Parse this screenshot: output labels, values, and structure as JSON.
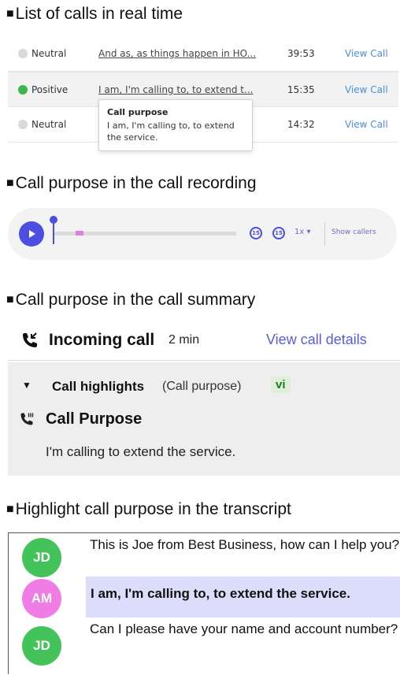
{
  "sections": {
    "calls_list": "List of calls  in real time",
    "recording": "Call purpose in the call recording",
    "summary": "Call purpose in the call summary",
    "transcript": "Highlight call purpose in the transcript"
  },
  "calls": [
    {
      "sentiment": "Neutral",
      "color": "#d9d9d9",
      "snippet": "And as, as things happen in HO...",
      "duration": "39:53",
      "action": "View Call"
    },
    {
      "sentiment": "Positive",
      "color": "#3cb54a",
      "snippet": "I am, I'm calling to, to extend t...",
      "duration": "15:35",
      "action": "View Call"
    },
    {
      "sentiment": "Neutral",
      "color": "#d9d9d9",
      "snippet": "",
      "duration": "14:32",
      "action": "View Call"
    }
  ],
  "tooltip": {
    "title": "Call purpose",
    "body": "I am, I'm calling to, to extend the service."
  },
  "player": {
    "skip_back": "15",
    "skip_forward": "15",
    "speed": "1x ▾",
    "show_callers": "Show callers",
    "accent": "#4b4ee0"
  },
  "summary": {
    "title": "Incoming call",
    "duration": "2 min",
    "details_link": "View call details",
    "highlights_label": "Call highlights",
    "highlights_sub": "(Call purpose)",
    "badge": "vi",
    "purpose_title": "Call Purpose",
    "purpose_text": "I'm calling to extend the service."
  },
  "transcript": [
    {
      "initials": "JD",
      "color": "#44c35a",
      "text": "This is Joe from Best Business, how can I help you?",
      "highlighted": false
    },
    {
      "initials": "AM",
      "color": "#f07ce6",
      "text": "I am, I'm calling to, to extend the service.",
      "highlighted": true
    },
    {
      "initials": "JD",
      "color": "#44c35a",
      "text": "Can I please have your name and account number?",
      "highlighted": false
    }
  ]
}
